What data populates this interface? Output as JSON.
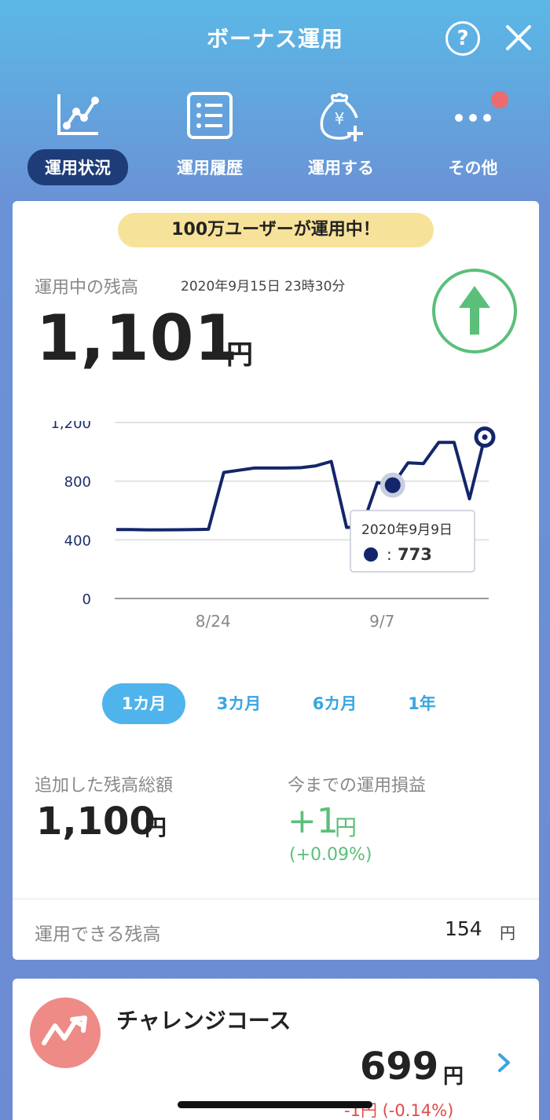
{
  "header": {
    "title": "ボーナス運用",
    "help_label": "?"
  },
  "nav": {
    "items": [
      {
        "label": "運用状況",
        "icon": "line-chart-icon",
        "active": true
      },
      {
        "label": "運用履歴",
        "icon": "list-icon",
        "active": false
      },
      {
        "label": "運用する",
        "icon": "money-bag-add-icon",
        "active": false
      },
      {
        "label": "その他",
        "icon": "more-icon",
        "active": false
      }
    ]
  },
  "banner": {
    "text": "100万ユーザーが運用中！"
  },
  "balance": {
    "label": "運用中の残高",
    "date": "2020年9月15日 23時30分",
    "amount": "1,101",
    "unit": "円",
    "trend_icon": "arrow-up-icon"
  },
  "chart_data": {
    "type": "line",
    "y_ticks": [
      "1,200",
      "800",
      "400",
      "0"
    ],
    "x_tick_labels": [
      "8/24",
      "9/7"
    ],
    "ylim": [
      0,
      1200
    ],
    "grid": true,
    "series": [
      {
        "color": "#13266b",
        "points": [
          [
            0,
            470
          ],
          [
            1,
            470
          ],
          [
            2,
            468
          ],
          [
            3,
            468
          ],
          [
            4,
            469
          ],
          [
            5,
            470
          ],
          [
            6,
            472
          ],
          [
            7,
            860
          ],
          [
            8,
            875
          ],
          [
            9,
            890
          ],
          [
            10,
            890
          ],
          [
            11,
            890
          ],
          [
            12,
            892
          ],
          [
            13,
            905
          ],
          [
            14,
            935
          ],
          [
            15,
            485
          ],
          [
            16,
            488
          ],
          [
            17,
            790
          ],
          [
            18,
            773
          ],
          [
            19,
            925
          ],
          [
            20,
            920
          ],
          [
            21,
            1065
          ],
          [
            22,
            1065
          ],
          [
            23,
            680
          ],
          [
            24,
            1101
          ]
        ]
      }
    ],
    "tooltip": {
      "date": "2020年9月9日",
      "value": "773",
      "separator": ":"
    }
  },
  "periods": [
    {
      "label": "1カ月",
      "active": true
    },
    {
      "label": "3カ月",
      "active": false
    },
    {
      "label": "6カ月",
      "active": false
    },
    {
      "label": "1年",
      "active": false
    }
  ],
  "stats": {
    "added_label": "追加した残高総額",
    "added_value": "1,100",
    "added_unit": "円",
    "pl_label": "今までの運用損益",
    "pl_value": "+1",
    "pl_unit": "円",
    "pl_percent": "(+0.09%)",
    "pl_color": "#5bbf7a"
  },
  "available": {
    "label": "運用できる残高",
    "value": "154",
    "unit": "円"
  },
  "course": {
    "name": "チャレンジコース",
    "value": "699",
    "unit": "円",
    "change": "-1円 (-0.14%)",
    "icon": "trend-up-icon",
    "chevron": "chevron-right-icon"
  }
}
